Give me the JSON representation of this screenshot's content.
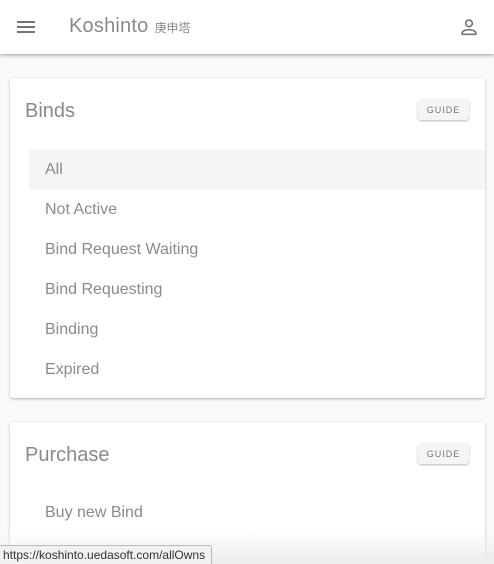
{
  "app_bar": {
    "title": "Koshinto",
    "subtitle": "庚申塔",
    "menu_icon": "menu-icon",
    "account_icon": "account-icon"
  },
  "binds": {
    "title": "Binds",
    "guide_label": "GUIDE",
    "items": [
      {
        "label": "All",
        "selected": true
      },
      {
        "label": "Not Active",
        "selected": false
      },
      {
        "label": "Bind Request Waiting",
        "selected": false
      },
      {
        "label": "Bind Requesting",
        "selected": false
      },
      {
        "label": "Binding",
        "selected": false
      },
      {
        "label": "Expired",
        "selected": false
      }
    ]
  },
  "purchase": {
    "title": "Purchase",
    "guide_label": "GUIDE",
    "items": [
      {
        "label": "Buy new Bind"
      }
    ]
  },
  "status_bar": {
    "url": "https://koshinto.uedasoft.com/allOwns"
  }
}
